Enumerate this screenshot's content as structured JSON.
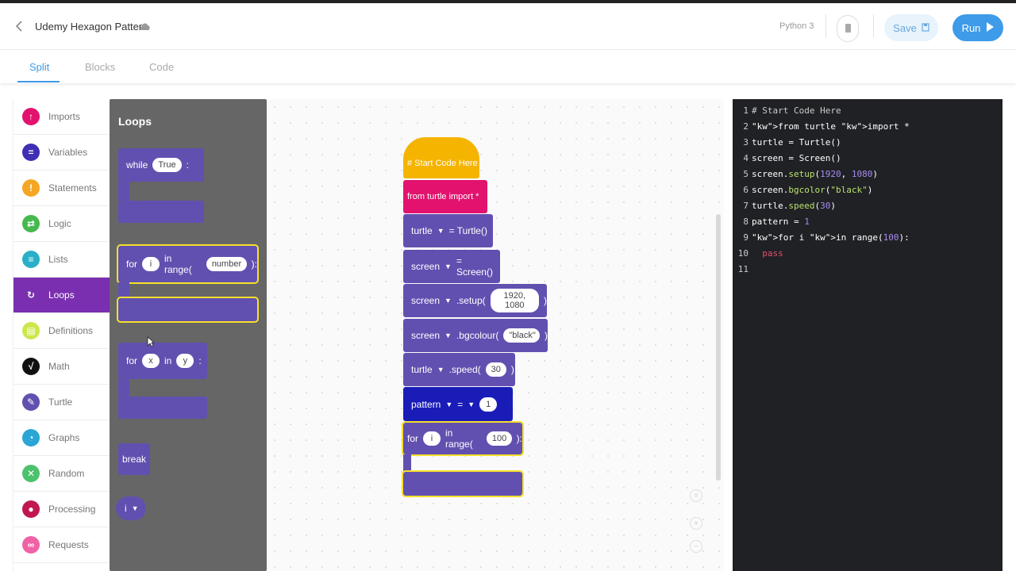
{
  "header": {
    "back_icon": "chevron-left-icon",
    "title": "Udemy Hexagon Pattern",
    "cloud_icon": "cloud-save-icon",
    "language": "Python 3",
    "save_label": "Save",
    "run_label": "Run"
  },
  "tabs": [
    {
      "label": "Split",
      "active": true
    },
    {
      "label": "Blocks",
      "active": false
    },
    {
      "label": "Code",
      "active": false
    }
  ],
  "categories": [
    {
      "label": "Imports",
      "color": "#e2126e",
      "icon": "upload-icon"
    },
    {
      "label": "Variables",
      "color": "#3f2fb5",
      "icon": "equals-icon"
    },
    {
      "label": "Statements",
      "color": "#f5a623",
      "icon": "exclamation-icon"
    },
    {
      "label": "Logic",
      "color": "#44b94d",
      "icon": "swap-icon"
    },
    {
      "label": "Lists",
      "color": "#29b0c8",
      "icon": "list-icon"
    },
    {
      "label": "Loops",
      "color": "#7a2fb0",
      "icon": "loop-icon",
      "active": true
    },
    {
      "label": "Definitions",
      "color": "#cbe84b",
      "icon": "doc-icon"
    },
    {
      "label": "Math",
      "color": "#111111",
      "icon": "sqrt-icon"
    },
    {
      "label": "Turtle",
      "color": "#6250b0",
      "icon": "pen-icon"
    },
    {
      "label": "Graphs",
      "color": "#29a5d6",
      "icon": "pie-icon"
    },
    {
      "label": "Random",
      "color": "#4cc26d",
      "icon": "shuffle-icon"
    },
    {
      "label": "Processing",
      "color": "#c0174f",
      "icon": "palette-icon"
    },
    {
      "label": "Requests",
      "color": "#f062a6",
      "icon": "link-icon"
    }
  ],
  "flyout": {
    "title": "Loops",
    "while_kw": "while",
    "while_cond": "True",
    "while_colon": ":",
    "for_kw": "for",
    "for_var": "i",
    "for_range": "in range(",
    "for_arg": "number",
    "for_end": "):",
    "forin_var": "x",
    "forin_in": "in",
    "forin_iter": "y",
    "forin_colon": ":",
    "break": "break",
    "i_var": "i"
  },
  "workspace": {
    "start": "# Start Code Here",
    "import": "from turtle import *",
    "turtle_var": "turtle",
    "turtle_assign": "= Turtle()",
    "screen_var": "screen",
    "screen_assign": "= Screen()",
    "setup_method": ".setup(",
    "setup_args": "1920, 1080",
    "paren": ")",
    "bgcolour_method": ".bgcolour(",
    "bgcolour_arg": "\"black\"",
    "speed_method": ".speed(",
    "speed_arg": "30",
    "pattern_var": "pattern",
    "pattern_eq": "=",
    "pattern_val": "1",
    "for_kw": "for",
    "for_var": "i",
    "for_range": "in range(",
    "for_arg": "100",
    "for_end": "):"
  },
  "code_lines": [
    {
      "n": "1",
      "text": "# Start Code Here"
    },
    {
      "n": "2",
      "text": "from turtle import *"
    },
    {
      "n": "3",
      "text": "turtle = Turtle()"
    },
    {
      "n": "4",
      "text": "screen = Screen()"
    },
    {
      "n": "5",
      "text": "screen.setup(1920, 1080)"
    },
    {
      "n": "6",
      "text": "screen.bgcolor(\"black\")"
    },
    {
      "n": "7",
      "text": "turtle.speed(30)"
    },
    {
      "n": "8",
      "text": "pattern = 1"
    },
    {
      "n": "9",
      "text": "for i in range(100):"
    },
    {
      "n": "10",
      "text": "  pass"
    },
    {
      "n": "11",
      "text": ""
    }
  ]
}
